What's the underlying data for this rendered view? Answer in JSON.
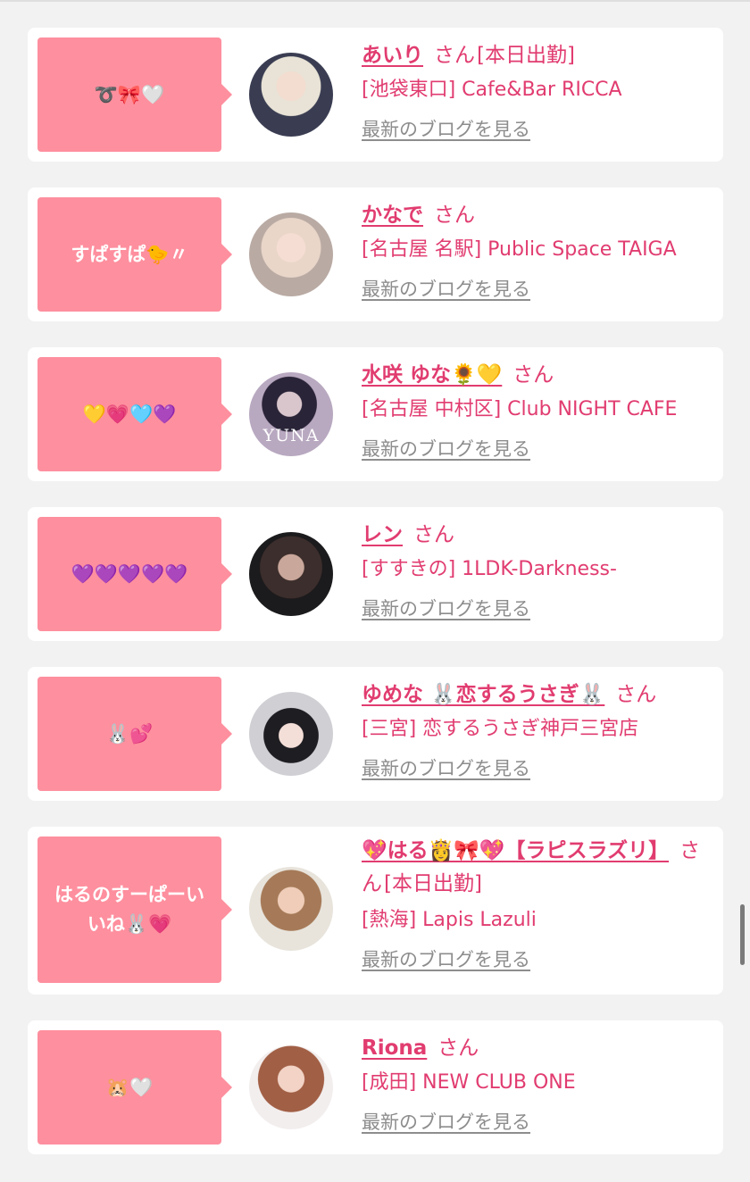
{
  "cards": [
    {
      "bubble_text": "➰🎀🤍",
      "name": "あいり",
      "san": "さん",
      "status": "[本日出勤]",
      "shop": "[池袋東口] Cafe&Bar RICCA",
      "blog_link": "最新のブログを見る"
    },
    {
      "bubble_text": "すぱすぱ🐤〃",
      "name": "かなで",
      "san": "さん",
      "status": "",
      "shop": "[名古屋 名駅] Public Space TAIGA",
      "blog_link": "最新のブログを見る"
    },
    {
      "bubble_text": "💛💗🩵💜",
      "name": "水咲 ゆな🌻💛",
      "san": "さん",
      "status": "",
      "shop": "[名古屋 中村区] Club NIGHT CAFE",
      "blog_link": "最新のブログを見る",
      "avatar_label": "YUNA"
    },
    {
      "bubble_text": "💜💜💜💜💜",
      "name": "レン",
      "san": "さん",
      "status": "",
      "shop": "[すすきの] 1LDK-Darkness-",
      "blog_link": "最新のブログを見る"
    },
    {
      "bubble_text": "🐰💕",
      "name": "ゆめな 🐰恋するうさぎ🐰",
      "san": "さん",
      "status": "",
      "shop": "[三宮] 恋するうさぎ神戸三宮店",
      "blog_link": "最新のブログを見る"
    },
    {
      "bubble_text": "はるのすーぱーいいね🐰💗",
      "name": "💖はる👸🎀💖【ラピスラズリ】",
      "san": "さん",
      "status": "[本日出勤]",
      "shop": "[熱海] Lapis Lazuli",
      "blog_link": "最新のブログを見る"
    },
    {
      "bubble_text": "🐹🤍",
      "name": "Riona",
      "san": "さん",
      "status": "",
      "shop": "[成田] NEW CLUB ONE",
      "blog_link": "最新のブログを見る"
    }
  ],
  "colors": {
    "bubble": "#fe8f9e",
    "accent_text": "#e13c70",
    "link_gray": "#8d8d8d",
    "background": "#f2f2f2"
  }
}
